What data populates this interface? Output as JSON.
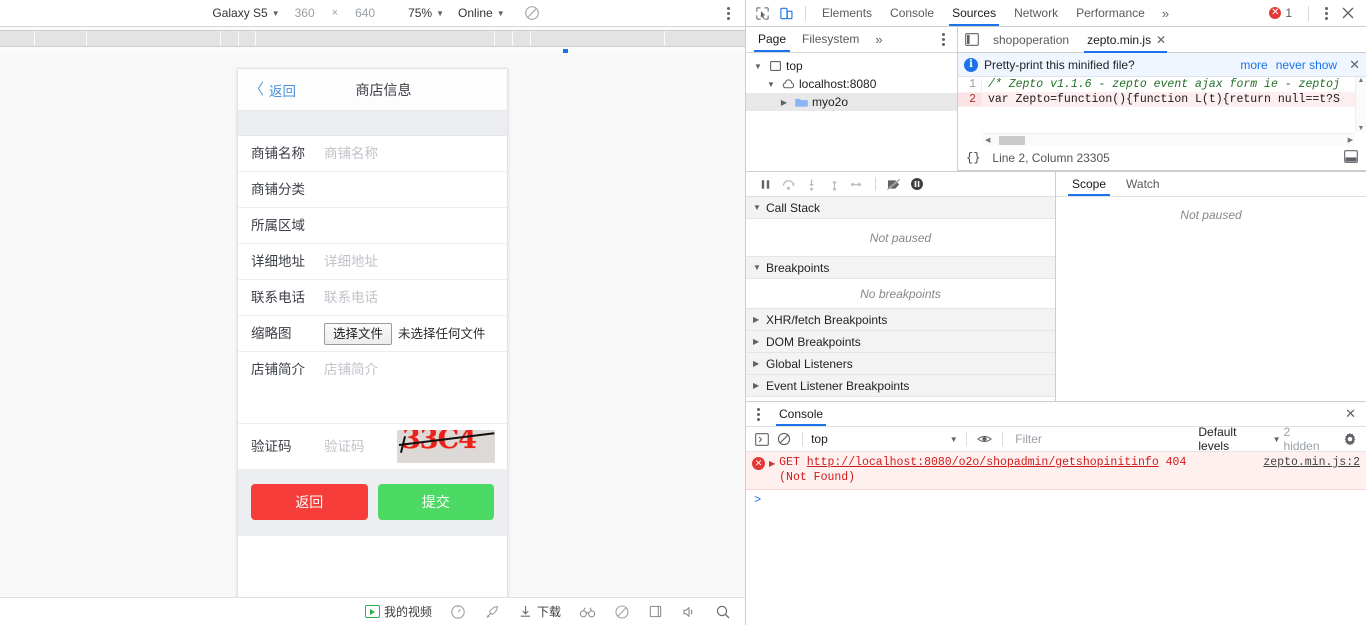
{
  "device_toolbar": {
    "device": "Galaxy S5",
    "width": "360",
    "separator": "×",
    "height": "640",
    "zoom": "75%",
    "throttling": "Online",
    "rotate_icon": "rotate-icon",
    "menu_icon": "more-vertical-icon"
  },
  "phone": {
    "back_label": "返回",
    "title": "商店信息",
    "rows": [
      {
        "label": "商铺名称",
        "placeholder": "商铺名称",
        "value": ""
      },
      {
        "label": "商铺分类",
        "placeholder": "",
        "value": ""
      },
      {
        "label": "所属区域",
        "placeholder": "",
        "value": ""
      },
      {
        "label": "详细地址",
        "placeholder": "详细地址",
        "value": ""
      },
      {
        "label": "联系电话",
        "placeholder": "联系电话",
        "value": ""
      }
    ],
    "thumbnail": {
      "label": "缩略图",
      "choose_button": "选择文件",
      "no_file_text": "未选择任何文件"
    },
    "description": {
      "label": "店铺简介",
      "placeholder": "店铺简介"
    },
    "captcha": {
      "label": "验证码",
      "placeholder": "验证码",
      "image_text": "33C4",
      "image_text_color": "#e8221a",
      "image_bg": "#ddd9d6"
    },
    "buttons": {
      "back": {
        "label": "返回",
        "color": "#f63d3a"
      },
      "submit": {
        "label": "提交",
        "color": "#4cd964"
      }
    }
  },
  "taskbar": {
    "items": [
      {
        "icon": "video-play-icon",
        "label": "我的视频"
      },
      {
        "icon": "speedometer-icon",
        "label": ""
      },
      {
        "icon": "rocket-icon",
        "label": ""
      },
      {
        "icon": "download-icon",
        "label": "下载"
      },
      {
        "icon": "glasses-icon",
        "label": ""
      },
      {
        "icon": "leaf-icon",
        "label": ""
      },
      {
        "icon": "window-icon",
        "label": ""
      },
      {
        "icon": "volume-icon",
        "label": ""
      },
      {
        "icon": "search-icon",
        "label": ""
      }
    ]
  },
  "devtools": {
    "inspect_icon": "inspect-element-icon",
    "device_icon": "toggle-device-toolbar-icon",
    "tabs": [
      {
        "label": "Elements",
        "active": false
      },
      {
        "label": "Console",
        "active": false
      },
      {
        "label": "Sources",
        "active": true
      },
      {
        "label": "Network",
        "active": false
      },
      {
        "label": "Performance",
        "active": false
      }
    ],
    "more_tabs_icon": "chevron-double-right-icon",
    "error_count": "1",
    "menu_icon": "more-vertical-icon",
    "close_icon": "close-icon",
    "navigator": {
      "tabs": [
        {
          "label": "Page",
          "active": true
        },
        {
          "label": "Filesystem",
          "active": false
        }
      ],
      "more_icon": "chevron-double-right-icon",
      "menu_icon": "more-vertical-icon",
      "tree": [
        {
          "label": "top",
          "icon": "frame-icon",
          "indent": 0,
          "expanded": true,
          "selected": false
        },
        {
          "label": "localhost:8080",
          "icon": "cloud-icon",
          "indent": 1,
          "expanded": true,
          "selected": false
        },
        {
          "label": "myo2o",
          "icon": "folder-icon",
          "indent": 2,
          "expanded": false,
          "selected": true
        }
      ]
    },
    "editor": {
      "tabs": [
        {
          "label": "shopoperation",
          "active": false,
          "closable": false
        },
        {
          "label": "zepto.min.js",
          "active": true,
          "closable": true
        }
      ],
      "panel_icon": "show-navigator-icon",
      "infobar": {
        "text": "Pretty-print this minified file?",
        "more_link": "more",
        "never_link": "never show",
        "close_icon": "close-icon",
        "info_icon": "info-icon"
      },
      "lines": [
        {
          "num": "1",
          "text": "/* Zepto v1.1.6 - zepto event ajax form ie - zeptoj",
          "kind": "comment",
          "highlight": false
        },
        {
          "num": "2",
          "text": "var Zepto=function(){function L(t){return null==t?S",
          "kind": "code",
          "highlight": true
        }
      ],
      "status": {
        "braces": "{}",
        "position": "Line 2, Column 23305",
        "format_icon": "format-icon"
      }
    },
    "debugger": {
      "toolbar_icons": [
        "pause-icon",
        "step-over-icon",
        "step-into-icon",
        "step-out-icon",
        "step-icon",
        "deactivate-breakpoints-icon",
        "pause-on-exceptions-icon"
      ],
      "sections": [
        {
          "title": "Call Stack",
          "expanded": true,
          "body": "Not paused"
        },
        {
          "title": "Breakpoints",
          "expanded": true,
          "body": "No breakpoints"
        },
        {
          "title": "XHR/fetch Breakpoints",
          "expanded": false,
          "body": ""
        },
        {
          "title": "DOM Breakpoints",
          "expanded": false,
          "body": ""
        },
        {
          "title": "Global Listeners",
          "expanded": false,
          "body": ""
        },
        {
          "title": "Event Listener Breakpoints",
          "expanded": false,
          "body": ""
        }
      ],
      "scope_tabs": [
        {
          "label": "Scope",
          "active": true
        },
        {
          "label": "Watch",
          "active": false
        }
      ],
      "scope_body": "Not paused"
    },
    "console": {
      "menu_icon": "more-vertical-icon",
      "tab_label": "Console",
      "close_icon": "close-icon",
      "sidebar_icon": "show-console-sidebar-icon",
      "clear_icon": "clear-console-icon",
      "context": "top",
      "eye_icon": "live-expression-icon",
      "filter_placeholder": "Filter",
      "filter_value": "",
      "levels": "Default levels",
      "hidden_count": "2 hidden",
      "settings_icon": "gear-icon",
      "messages": [
        {
          "level": "error",
          "method": "GET",
          "url": "http://localhost:8080/o2o/shopadmin/getshopinitinfo",
          "status": "404 (Not Found)",
          "source": "zepto.min.js:2"
        }
      ],
      "prompt": ">"
    }
  }
}
